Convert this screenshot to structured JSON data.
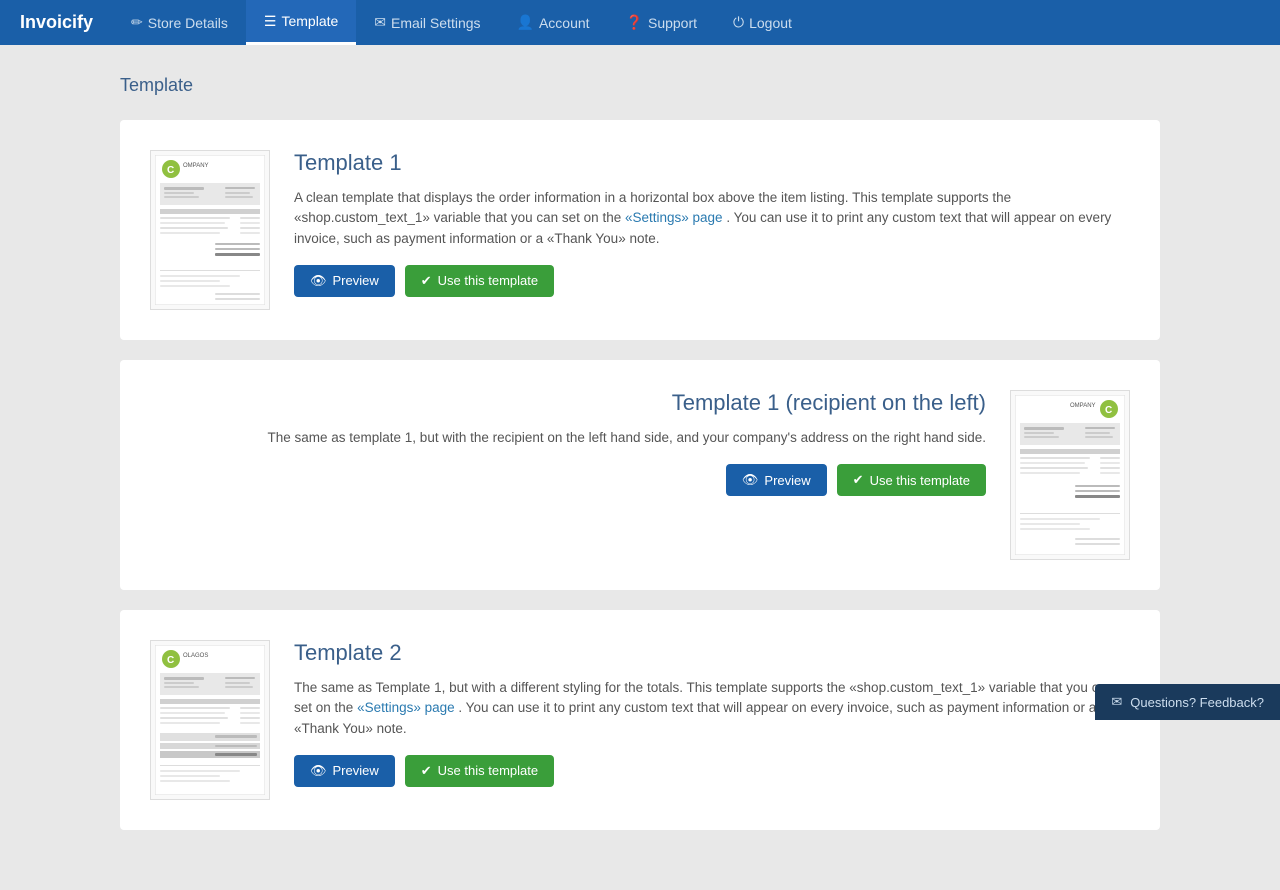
{
  "nav": {
    "brand": "Invoicify",
    "items": [
      {
        "label": "Store Details",
        "icon": "✏",
        "active": false
      },
      {
        "label": "Template",
        "icon": "☰",
        "active": true
      },
      {
        "label": "Email Settings",
        "icon": "✉",
        "active": false
      },
      {
        "label": "Account",
        "icon": "👤",
        "active": false
      },
      {
        "label": "Support",
        "icon": "❓",
        "active": false
      },
      {
        "label": "Logout",
        "icon": "⏻",
        "active": false
      }
    ]
  },
  "page": {
    "title": "Template"
  },
  "templates": [
    {
      "id": "template1",
      "title": "Template 1",
      "description": "A clean template that displays the order information in a horizontal box above the item listing. This template supports the «shop.custom_text_1» variable that you can set on the",
      "link_text": "«Settings» page",
      "description_end": ". You can use it to print any custom text that will appear on every invoice, such as payment information or a «Thank You» note.",
      "preview_label": "Preview",
      "use_label": "Use this template",
      "image_side": "left"
    },
    {
      "id": "template1-left",
      "title": "Template 1 (recipient on the left)",
      "description": "The same as template 1, but with the recipient on the left hand side, and your company's address on the right hand side.",
      "link_text": "",
      "description_end": "",
      "preview_label": "Preview",
      "use_label": "Use this template",
      "image_side": "right"
    },
    {
      "id": "template2",
      "title": "Template 2",
      "description": "The same as Template 1, but with a different styling for the totals. This template supports the «shop.custom_text_1» variable that you can set on the",
      "link_text": "«Settings» page",
      "description_end": ". You can use it to print any custom text that will appear on every invoice, such as payment information or a «Thank You» note.",
      "preview_label": "Preview",
      "use_label": "Use this template",
      "image_side": "left"
    }
  ],
  "feedback": {
    "icon": "✉",
    "label": "Questions? Feedback?"
  }
}
